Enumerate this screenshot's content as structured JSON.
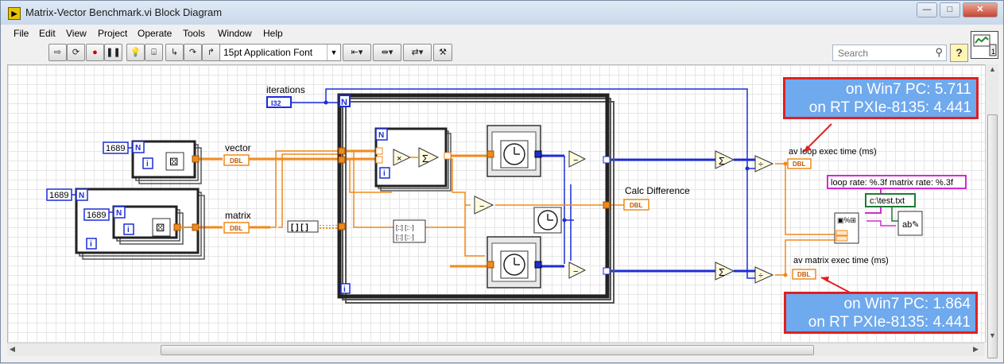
{
  "window": {
    "title": "Matrix-Vector Benchmark.vi Block Diagram",
    "icon": "labview-vi-icon"
  },
  "menu": [
    "File",
    "Edit",
    "View",
    "Project",
    "Operate",
    "Tools",
    "Window",
    "Help"
  ],
  "toolbar": {
    "font_selector": "15pt Application Font",
    "search_placeholder": "Search",
    "help_label": "?"
  },
  "diagram": {
    "iterations_label": "iterations",
    "iterations_type": "I32",
    "n_label": "N",
    "i_label": "i",
    "vector_count": "1689",
    "matrix_outer_count": "1689",
    "matrix_inner_count": "1689",
    "vector_label": "vector",
    "matrix_label": "matrix",
    "dbl": "DBL",
    "calc_difference": "Calc Difference",
    "av_loop_label": "av loop exec time (ms)",
    "av_matrix_label": "av matrix exec time (ms)",
    "format_string": "loop rate: %.3f   matrix rate: %.3f",
    "file_path": "c:\\test.txt"
  },
  "annotations": {
    "loop_line1": "on Win7 PC:  5.711",
    "loop_line2": "on RT PXIe-8135:  4.441",
    "matrix_line1": "on Win7 PC:  1.864",
    "matrix_line2": "on RT PXIe-8135:  4.441"
  }
}
